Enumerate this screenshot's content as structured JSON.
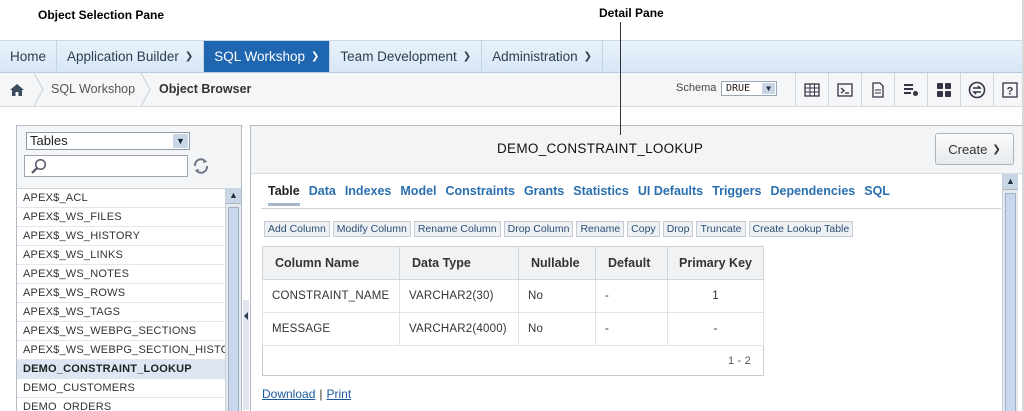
{
  "callouts": {
    "left": "Object Selection Pane",
    "right": "Detail Pane"
  },
  "nav": {
    "items": [
      {
        "label": "Home",
        "has_menu": false
      },
      {
        "label": "Application Builder",
        "has_menu": true
      },
      {
        "label": "SQL Workshop",
        "has_menu": true,
        "active": true
      },
      {
        "label": "Team Development",
        "has_menu": true
      },
      {
        "label": "Administration",
        "has_menu": true
      }
    ]
  },
  "breadcrumb": {
    "items": [
      "SQL Workshop",
      "Object Browser"
    ]
  },
  "schema": {
    "label": "Schema",
    "value": "DRUE"
  },
  "toolbar_icons": [
    "table-icon",
    "sql-command-icon",
    "script-icon",
    "query-builder-icon",
    "utilities-icon",
    "restful-icon",
    "help-icon"
  ],
  "object_pane": {
    "type_select": "Tables",
    "search_value": "",
    "objects": [
      "APEX$_ACL",
      "APEX$_WS_FILES",
      "APEX$_WS_HISTORY",
      "APEX$_WS_LINKS",
      "APEX$_WS_NOTES",
      "APEX$_WS_ROWS",
      "APEX$_WS_TAGS",
      "APEX$_WS_WEBPG_SECTIONS",
      "APEX$_WS_WEBPG_SECTION_HISTORY",
      "DEMO_CONSTRAINT_LOOKUP",
      "DEMO_CUSTOMERS",
      "DEMO_ORDERS"
    ],
    "selected": "DEMO_CONSTRAINT_LOOKUP"
  },
  "detail": {
    "title": "DEMO_CONSTRAINT_LOOKUP",
    "create_label": "Create",
    "tabs": [
      "Table",
      "Data",
      "Indexes",
      "Model",
      "Constraints",
      "Grants",
      "Statistics",
      "UI Defaults",
      "Triggers",
      "Dependencies",
      "SQL"
    ],
    "active_tab": "Table",
    "actions": [
      "Add Column",
      "Modify Column",
      "Rename Column",
      "Drop Column",
      "Rename",
      "Copy",
      "Drop",
      "Truncate",
      "Create Lookup Table"
    ],
    "table": {
      "headers": [
        "Column Name",
        "Data Type",
        "Nullable",
        "Default",
        "Primary Key"
      ],
      "rows": [
        [
          "CONSTRAINT_NAME",
          "VARCHAR2(30)",
          "No",
          "-",
          "1"
        ],
        [
          "MESSAGE",
          "VARCHAR2(4000)",
          "No",
          "-",
          "-"
        ]
      ],
      "pagination": "1 - 2"
    },
    "links": {
      "download": "Download",
      "print": "Print",
      "separator": "|"
    }
  }
}
